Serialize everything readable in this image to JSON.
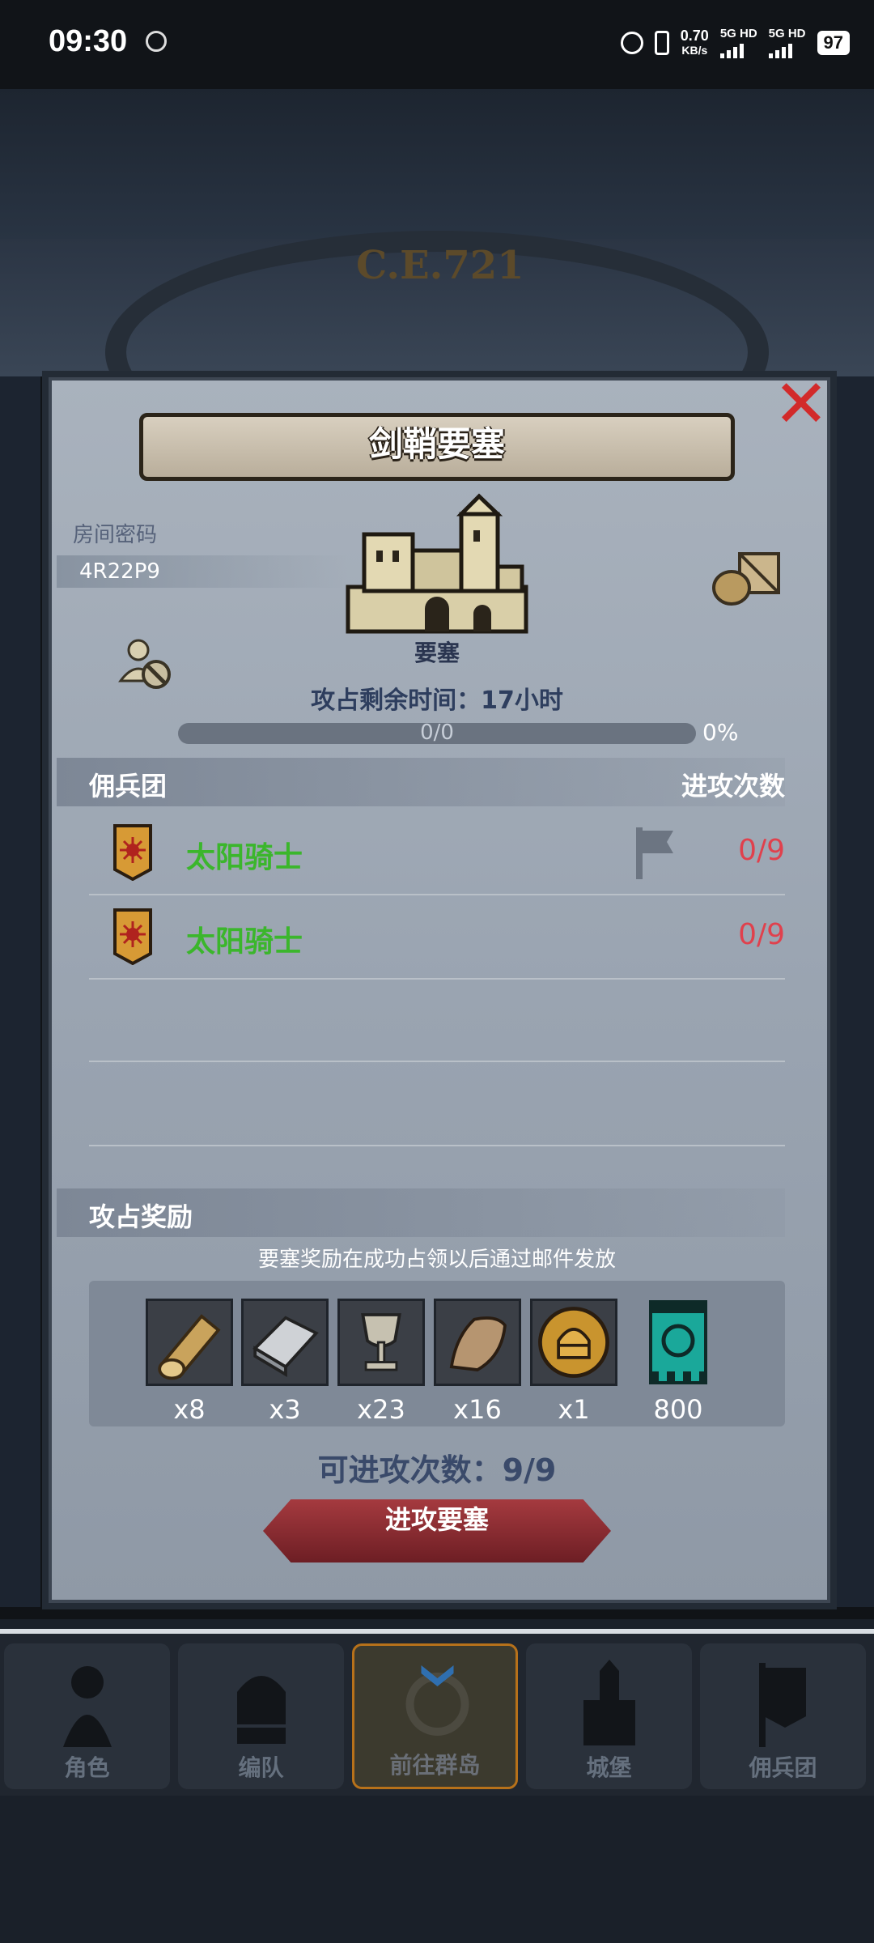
{
  "status_bar": {
    "time": "09:30",
    "speed_value": "0.70",
    "speed_unit": "KB/s",
    "net1": "5G HD",
    "net2": "5G HD",
    "battery": "97"
  },
  "header": {
    "era_label": "C.E.721"
  },
  "dialog": {
    "title": "剑鞘要塞",
    "room_label": "房间密码",
    "room_code": "4R22P9",
    "fortress_label": "要塞",
    "time_remaining": "攻占剩余时间：17小时",
    "progress_text": "0/0",
    "progress_percent": "0%",
    "mercenary_header": "佣兵团",
    "attack_count_header": "进攻次数",
    "rows": [
      {
        "name": "太阳骑士",
        "count": "0/9"
      },
      {
        "name": "太阳骑士",
        "count": "0/9"
      }
    ],
    "reward_header": "攻占奖励",
    "reward_note": "要塞奖励在成功占领以后通过邮件发放",
    "rewards": [
      {
        "icon": "wood-log-icon",
        "qty": "x8"
      },
      {
        "icon": "iron-ingot-icon",
        "qty": "x3"
      },
      {
        "icon": "goblet-icon",
        "qty": "x23"
      },
      {
        "icon": "fur-pelt-icon",
        "qty": "x16"
      },
      {
        "icon": "knight-helmet-coin-icon",
        "qty": "x1"
      },
      {
        "icon": "guild-banner-icon",
        "qty": "800"
      }
    ],
    "attempts_text": "可进攻次数：9/9",
    "attack_button": "进攻要塞"
  },
  "nav": {
    "items": [
      "角色",
      "编队",
      "前往群岛",
      "城堡",
      "佣兵团"
    ],
    "active": "前往群岛"
  },
  "colors": {
    "mercenary_name": "#3bb62c",
    "attack_count": "#e0414d",
    "attack_button": "#8e2a30",
    "close_x": "#d22a2a"
  }
}
